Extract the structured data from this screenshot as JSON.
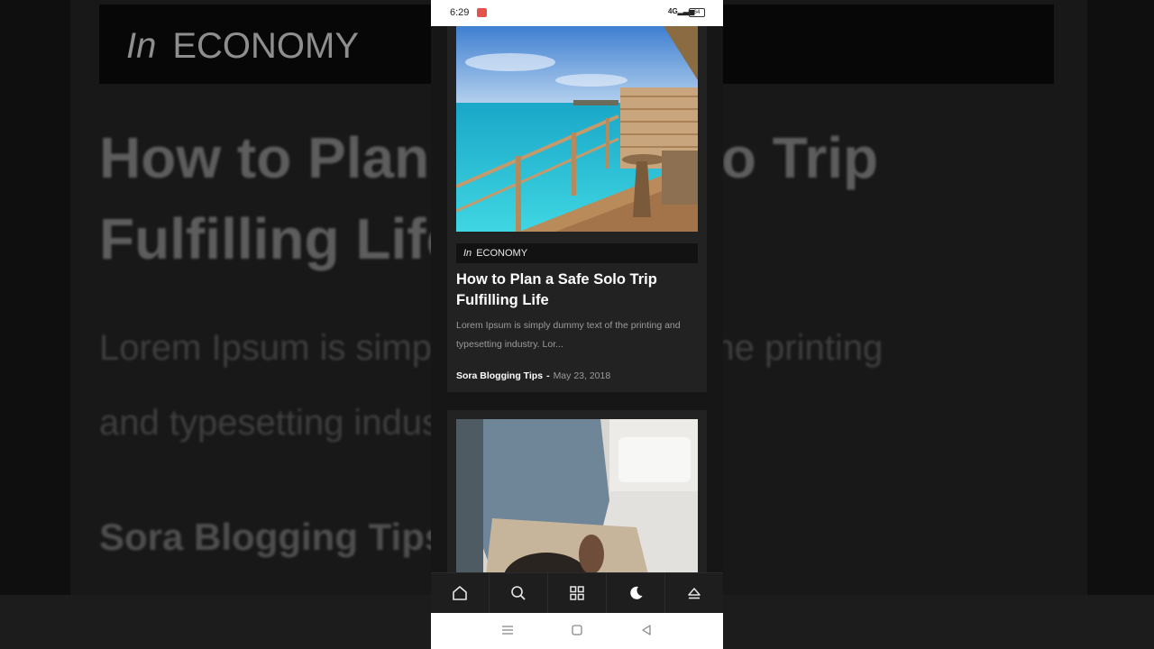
{
  "background": {
    "tag_prefix": "In",
    "tag_label": "ECONOMY",
    "title": "How to Plan a Safe Solo Trip\nFulfilling Life",
    "excerpt": "Lorem Ipsum is simply dummy text of the printing\nand typesetting industry. Lor...",
    "author": "Sora Blogging Tips"
  },
  "status_bar": {
    "time": "6:29",
    "network": "4G",
    "battery": "64"
  },
  "post": {
    "tag_prefix": "In",
    "tag_label": "ECONOMY",
    "title": "How to Plan a Safe Solo Trip Fulfilling Life",
    "excerpt": "Lorem Ipsum is simply dummy text of the printing and typesetting industry. Lor...",
    "author": "Sora Blogging Tips",
    "separator": "-",
    "date": "May 23, 2018"
  },
  "bottom_nav": {
    "items": [
      {
        "icon": "home-icon"
      },
      {
        "icon": "search-icon"
      },
      {
        "icon": "grid-icon"
      },
      {
        "icon": "moon-icon"
      },
      {
        "icon": "scroll-top-icon"
      }
    ]
  },
  "colors": {
    "page_bg": "#161616",
    "card_bg": "#222222",
    "tag_bg": "#121212",
    "accent_sea": "#2ec4d4"
  }
}
